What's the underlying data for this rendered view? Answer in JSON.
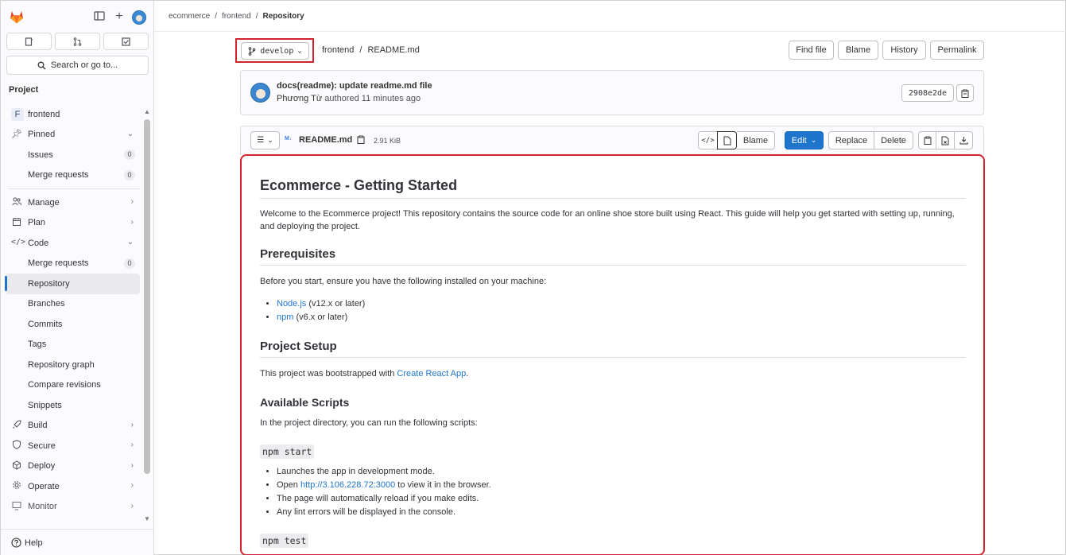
{
  "sidebar": {
    "search_label": "Search or go to...",
    "section_label": "Project",
    "project_initial": "F",
    "project_name": "frontend",
    "pinned": "Pinned",
    "issues": {
      "label": "Issues",
      "count": "0"
    },
    "merge_requests": {
      "label": "Merge requests",
      "count": "0"
    },
    "manage": "Manage",
    "plan": "Plan",
    "code": "Code",
    "code_items": {
      "merge_requests": {
        "label": "Merge requests",
        "count": "0"
      },
      "repository": "Repository",
      "branches": "Branches",
      "commits": "Commits",
      "tags": "Tags",
      "repository_graph": "Repository graph",
      "compare_revisions": "Compare revisions",
      "snippets": "Snippets"
    },
    "build": "Build",
    "secure": "Secure",
    "deploy": "Deploy",
    "operate": "Operate",
    "monitor": "Monitor",
    "help": "Help"
  },
  "breadcrumb": {
    "items": [
      "ecommerce",
      "frontend",
      "Repository"
    ],
    "separator": "/"
  },
  "toolbar": {
    "branch": "develop",
    "path_root": "frontend",
    "path_sep": "/",
    "path_file": "README.md",
    "find_file": "Find file",
    "blame": "Blame",
    "history": "History",
    "permalink": "Permalink"
  },
  "commit": {
    "title": "docs(readme): update readme.md file",
    "author": "Phương Từ",
    "meta": "authored 11 minutes ago",
    "sha": "2908e2de"
  },
  "file": {
    "name": "README.md",
    "size": "2.91 KiB",
    "blame": "Blame",
    "edit": "Edit",
    "replace": "Replace",
    "delete": "Delete"
  },
  "readme": {
    "h1": "Ecommerce - Getting Started",
    "intro": "Welcome to the Ecommerce project! This repository contains the source code for an online shoe store built using React. This guide will help you get started with setting up, running, and deploying the project.",
    "prereq_title": "Prerequisites",
    "prereq_text": "Before you start, ensure you have the following installed on your machine:",
    "prereq_items": [
      {
        "link": "Node.js",
        "text": " (v12.x or later)"
      },
      {
        "link": "npm",
        "text": " (v6.x or later)"
      }
    ],
    "setup_title": "Project Setup",
    "setup_text_pre": "This project was bootstrapped with ",
    "setup_link": "Create React App",
    "setup_text_post": ".",
    "scripts_title": "Available Scripts",
    "scripts_text": "In the project directory, you can run the following scripts:",
    "cmd_start": "npm start",
    "start_items": [
      "Launches the app in development mode.",
      "Open ",
      "The page will automatically reload if you make edits.",
      "Any lint errors will be displayed in the console."
    ],
    "start_link": "http://3.106.228.72:3000",
    "start_link_suffix": " to view it in the browser.",
    "cmd_test": "npm test"
  },
  "colors": {
    "accent": "#1f75cb",
    "highlight": "#d0242e"
  }
}
